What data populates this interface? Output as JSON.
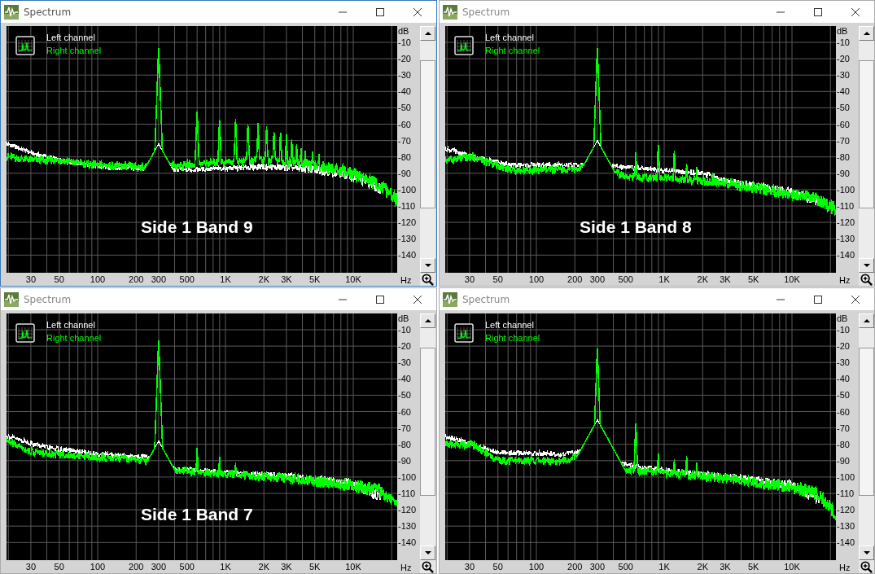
{
  "windows": [
    {
      "title": "Spectrum",
      "active": true,
      "legend": [
        {
          "label": "Left channel",
          "color": "#ffffff"
        },
        {
          "label": "Right channel",
          "color": "#00ff00"
        }
      ],
      "caption": "Side 1 Band 9",
      "y_axis": {
        "unit": "dB",
        "labels": [
          "-10",
          "-20",
          "-30",
          "-40",
          "-50",
          "-60",
          "-70",
          "-80",
          "-90",
          "-100",
          "-110",
          "-120",
          "-130",
          "-140"
        ]
      },
      "x_axis": {
        "labels": [
          "30",
          "50",
          "100",
          "200",
          "300",
          "500",
          "1K",
          "2K",
          "3K",
          "5K",
          "10K"
        ],
        "unit": "Hz"
      }
    },
    {
      "title": "Spectrum",
      "active": false,
      "legend": [
        {
          "label": "Left channel",
          "color": "#ffffff"
        },
        {
          "label": "Right channel",
          "color": "#00ff00"
        }
      ],
      "caption": "Side 1 Band 8",
      "y_axis": {
        "unit": "dB",
        "labels": [
          "-10",
          "-20",
          "-30",
          "-40",
          "-50",
          "-60",
          "-70",
          "-80",
          "-90",
          "-100",
          "-110",
          "-120",
          "-130",
          "-140"
        ]
      },
      "x_axis": {
        "labels": [
          "30",
          "50",
          "100",
          "200",
          "300",
          "500",
          "1K",
          "2K",
          "3K",
          "5K",
          "10K"
        ],
        "unit": "Hz"
      }
    },
    {
      "title": "Spectrum",
      "active": false,
      "legend": [
        {
          "label": "Left channel",
          "color": "#ffffff"
        },
        {
          "label": "Right channel",
          "color": "#00ff00"
        }
      ],
      "caption": "Side 1 Band 7",
      "y_axis": {
        "unit": "dB",
        "labels": [
          "-10",
          "-20",
          "-30",
          "-40",
          "-50",
          "-60",
          "-70",
          "-80",
          "-90",
          "-100",
          "-110",
          "-120",
          "-130",
          "-140"
        ]
      },
      "x_axis": {
        "labels": [
          "30",
          "50",
          "100",
          "200",
          "300",
          "500",
          "1K",
          "2K",
          "3K",
          "5K",
          "10K"
        ],
        "unit": "Hz"
      }
    },
    {
      "title": "Spectrum",
      "active": false,
      "legend": [
        {
          "label": "Left channel",
          "color": "#ffffff"
        },
        {
          "label": "Right channel",
          "color": "#00ff00"
        }
      ],
      "y_axis": {
        "unit": "dB",
        "labels": [
          "-10",
          "-20",
          "-30",
          "-40",
          "-50",
          "-60",
          "-70",
          "-80",
          "-90",
          "-100",
          "-110",
          "-120",
          "-130",
          "-140"
        ]
      },
      "x_axis": {
        "labels": [
          "30",
          "50",
          "100",
          "200",
          "300",
          "500",
          "1K",
          "2K",
          "3K",
          "5K",
          "10K"
        ],
        "unit": "Hz"
      }
    }
  ]
}
